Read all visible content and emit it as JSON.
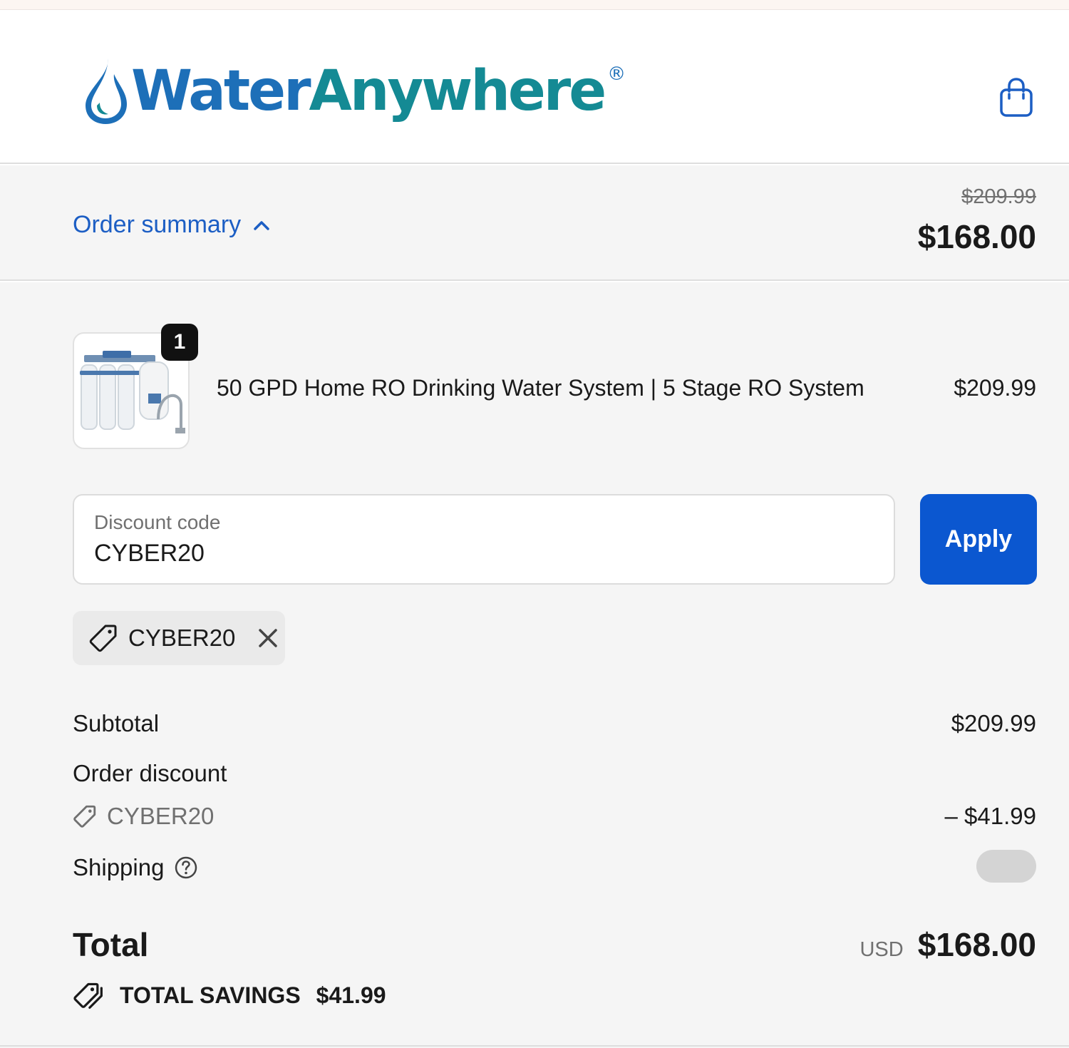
{
  "header": {
    "logo": {
      "word1": "Water",
      "word2": "Anywhere",
      "reg": "®"
    },
    "cart_icon": "shopping-bag-icon"
  },
  "summary": {
    "toggle_label": "Order summary",
    "original_total": "$209.99",
    "total": "$168.00"
  },
  "product": {
    "name": "50 GPD Home RO Drinking Water System | 5 Stage RO System",
    "price": "$209.99",
    "quantity": "1"
  },
  "discount": {
    "label": "Discount code",
    "value": "CYBER20",
    "apply_label": "Apply",
    "applied_code": "CYBER20"
  },
  "totals": {
    "subtotal_label": "Subtotal",
    "subtotal_value": "$209.99",
    "order_discount_label": "Order discount",
    "order_discount_code": "CYBER20",
    "order_discount_value": "– $41.99",
    "shipping_label": "Shipping",
    "total_label": "Total",
    "currency": "USD",
    "total_value": "$168.00",
    "savings_label": "TOTAL SAVINGS",
    "savings_value": "$41.99"
  },
  "colors": {
    "brand_blue": "#1d6fb8",
    "brand_teal": "#148a94",
    "link_blue": "#1c5ec4",
    "button_blue": "#0b57d0"
  }
}
